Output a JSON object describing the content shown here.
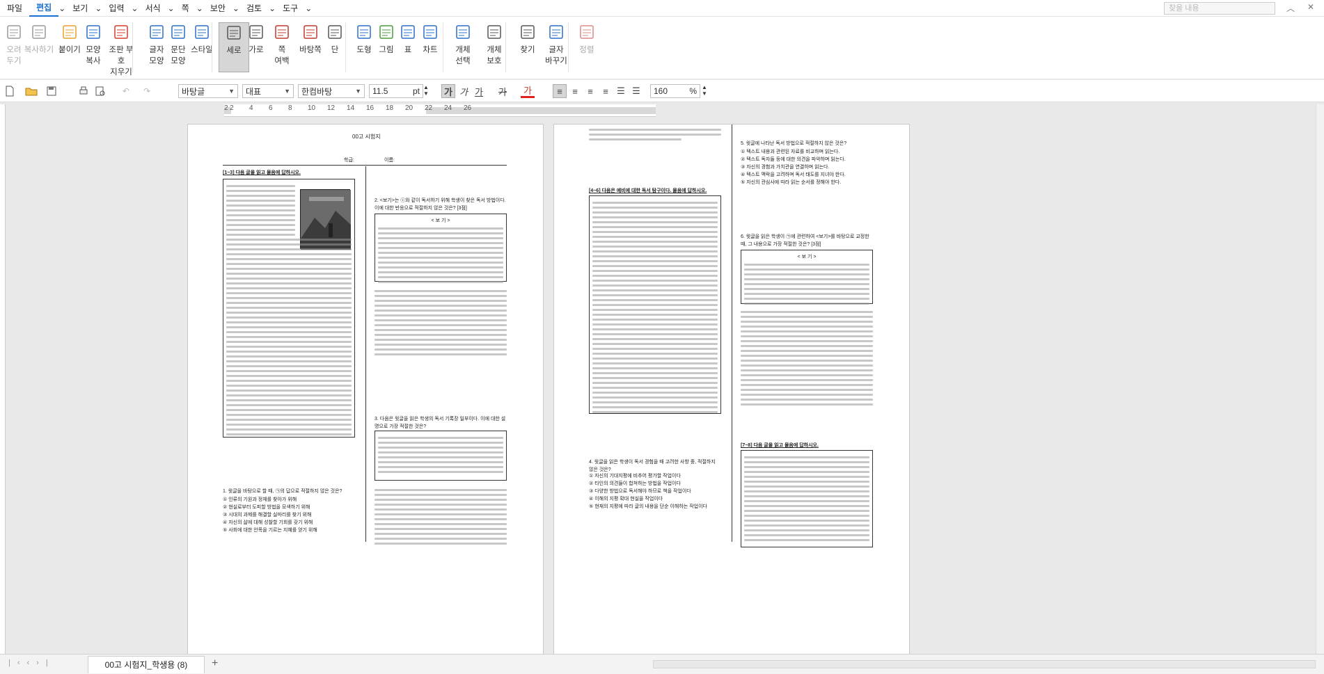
{
  "menubar": {
    "items": [
      "파일",
      "편집",
      "보기",
      "입력",
      "서식",
      "쪽",
      "보안",
      "검토",
      "도구"
    ],
    "active": "편집",
    "search_placeholder": "찾을 내용"
  },
  "ribbon": {
    "groups": [
      {
        "label": "오려\n두기",
        "icon": "scissors-icon",
        "disabled": true
      },
      {
        "label": "복사하기",
        "icon": "copy-icon",
        "disabled": true
      },
      {
        "label": "붙이기",
        "icon": "paste-icon",
        "disabled": false
      },
      {
        "label": "모양\n복사",
        "icon": "format-painter-icon",
        "disabled": false
      },
      {
        "label": "조판 부호\n지우기",
        "icon": "clear-codes-icon",
        "disabled": false
      },
      {
        "label": "글자\n모양",
        "icon": "char-shape-icon",
        "disabled": false
      },
      {
        "label": "문단\n모양",
        "icon": "para-shape-icon",
        "disabled": false
      },
      {
        "label": "스타일",
        "icon": "style-icon",
        "disabled": false
      },
      {
        "label": "세로",
        "icon": "portrait-icon",
        "disabled": false,
        "active": true
      },
      {
        "label": "가로",
        "icon": "landscape-icon",
        "disabled": false
      },
      {
        "label": "쪽\n여백",
        "icon": "page-margin-icon",
        "disabled": false
      },
      {
        "label": "바탕쪽",
        "icon": "master-page-icon",
        "disabled": false
      },
      {
        "label": "단",
        "icon": "columns-icon",
        "disabled": false
      },
      {
        "label": "도형",
        "icon": "shapes-icon",
        "disabled": false
      },
      {
        "label": "그림",
        "icon": "picture-icon",
        "disabled": false
      },
      {
        "label": "표",
        "icon": "table-icon",
        "disabled": false
      },
      {
        "label": "차트",
        "icon": "chart-icon",
        "disabled": false
      },
      {
        "label": "개체\n선택",
        "icon": "object-select-icon",
        "disabled": false
      },
      {
        "label": "개체\n보호",
        "icon": "object-protect-icon",
        "disabled": false
      },
      {
        "label": "찾기",
        "icon": "binoculars-icon",
        "disabled": false
      },
      {
        "label": "글자\n바꾸기",
        "icon": "char-replace-icon",
        "disabled": false
      },
      {
        "label": "정렬",
        "icon": "sort-icon",
        "disabled": true
      }
    ]
  },
  "toolbar": {
    "style": "바탕글",
    "lang": "대표",
    "font": "한컴바탕",
    "size": "11.5",
    "size_unit": "pt",
    "bold": "가",
    "italic": "가",
    "underline": "가",
    "strike": "가",
    "color": "가",
    "zoom": "160",
    "zoom_unit": "%"
  },
  "ruler": {
    "ticks": [
      "2",
      "2",
      "4",
      "6",
      "8",
      "10",
      "12",
      "14",
      "16",
      "18",
      "20",
      "22",
      "24",
      "26"
    ]
  },
  "page1": {
    "header": "00고 시험지",
    "name_label": "학급:",
    "name_label2": "이름:",
    "section1": "[1~3] 다음 글을 읽고 물음에 답하시오.",
    "q1": "1. 윗글을 바탕으로 할 때, ㉠의 답으로 적절하지 않은 것은?",
    "q1_choices": [
      "① 인류의 기원과 정체를 찾아가 위해",
      "② 현실로부터 도피할 방법을 모색하기 위해",
      "③ 시대의 과제를 해결할 실마리를 찾기 위해",
      "④ 자신의 삶에 대해 성찰할 기회를 갖기 위해",
      "⑤ 사회에 대한 안목을 기르는 지혜를 얻기 위해"
    ],
    "q2": "2. <보기>는 ⓒ와 같이 독서하기 위해 학생이 찾은 독서 방법이다. 이에 대한 반응으로 적절하지 않은 것은? [3점]",
    "bogi_label": "< 보 기 >",
    "q3": "3. 다음은 윗글을 읽은 학생의 독서 기록장 일부이다. 이에 대한 설명으로 가장 적절한 것은?"
  },
  "page2": {
    "q4_section": "[4~6] 다음은 예비에 대한 독서 탐구이다. 물음에 답하시오.",
    "q4": "4. 윗글을 읽은 학생이 독서 경험을 때 고려한 사항 중, 적절하지 않은 것은?",
    "q4_choices": [
      "① 자신의 기대지평에 비추어 평가할 작업이다",
      "② 타인의 의견들이 합쳐하는 방법을 작업이다",
      "③ 다양한 방법으로 독서해야 하므로 책을 작업이다",
      "④ 이해의 지평 확대 현실을 작업이다",
      "⑤ 현재의 지평에 따라 글의 내용을 단순 이해하는 작업이다"
    ],
    "q5": "5. 윗글에 나타난 독서 방법으로 적절하지 않은 것은?",
    "q5_choices": [
      "① 텍스트 내용과 관련된 자료를 비교하며 읽는다.",
      "② 텍스트 독자들 등에 대한 의견을 파악하며 읽는다.",
      "③ 자신의 경험과 가치관을 연결하며 읽는다.",
      "④ 텍스트 맥락을 고려하며 독서 태도를 지녀야 한다.",
      "⑤ 자신의 관심사에 따라 읽는 순서를 정해야 한다."
    ],
    "q6": "6. 윗글을 읽은 학생이 ㉠에 관련하여 <보기>를 바탕으로 교정한 때, 그 내용으로 가장 적절한 것은? [3점]",
    "bogi_label": "< 보 기 >",
    "q7_section": "[7~8] 다음 글을 읽고 물음에 답하시오."
  },
  "status": {
    "doc_tab": "00고 시험지_학생용 (8)"
  }
}
